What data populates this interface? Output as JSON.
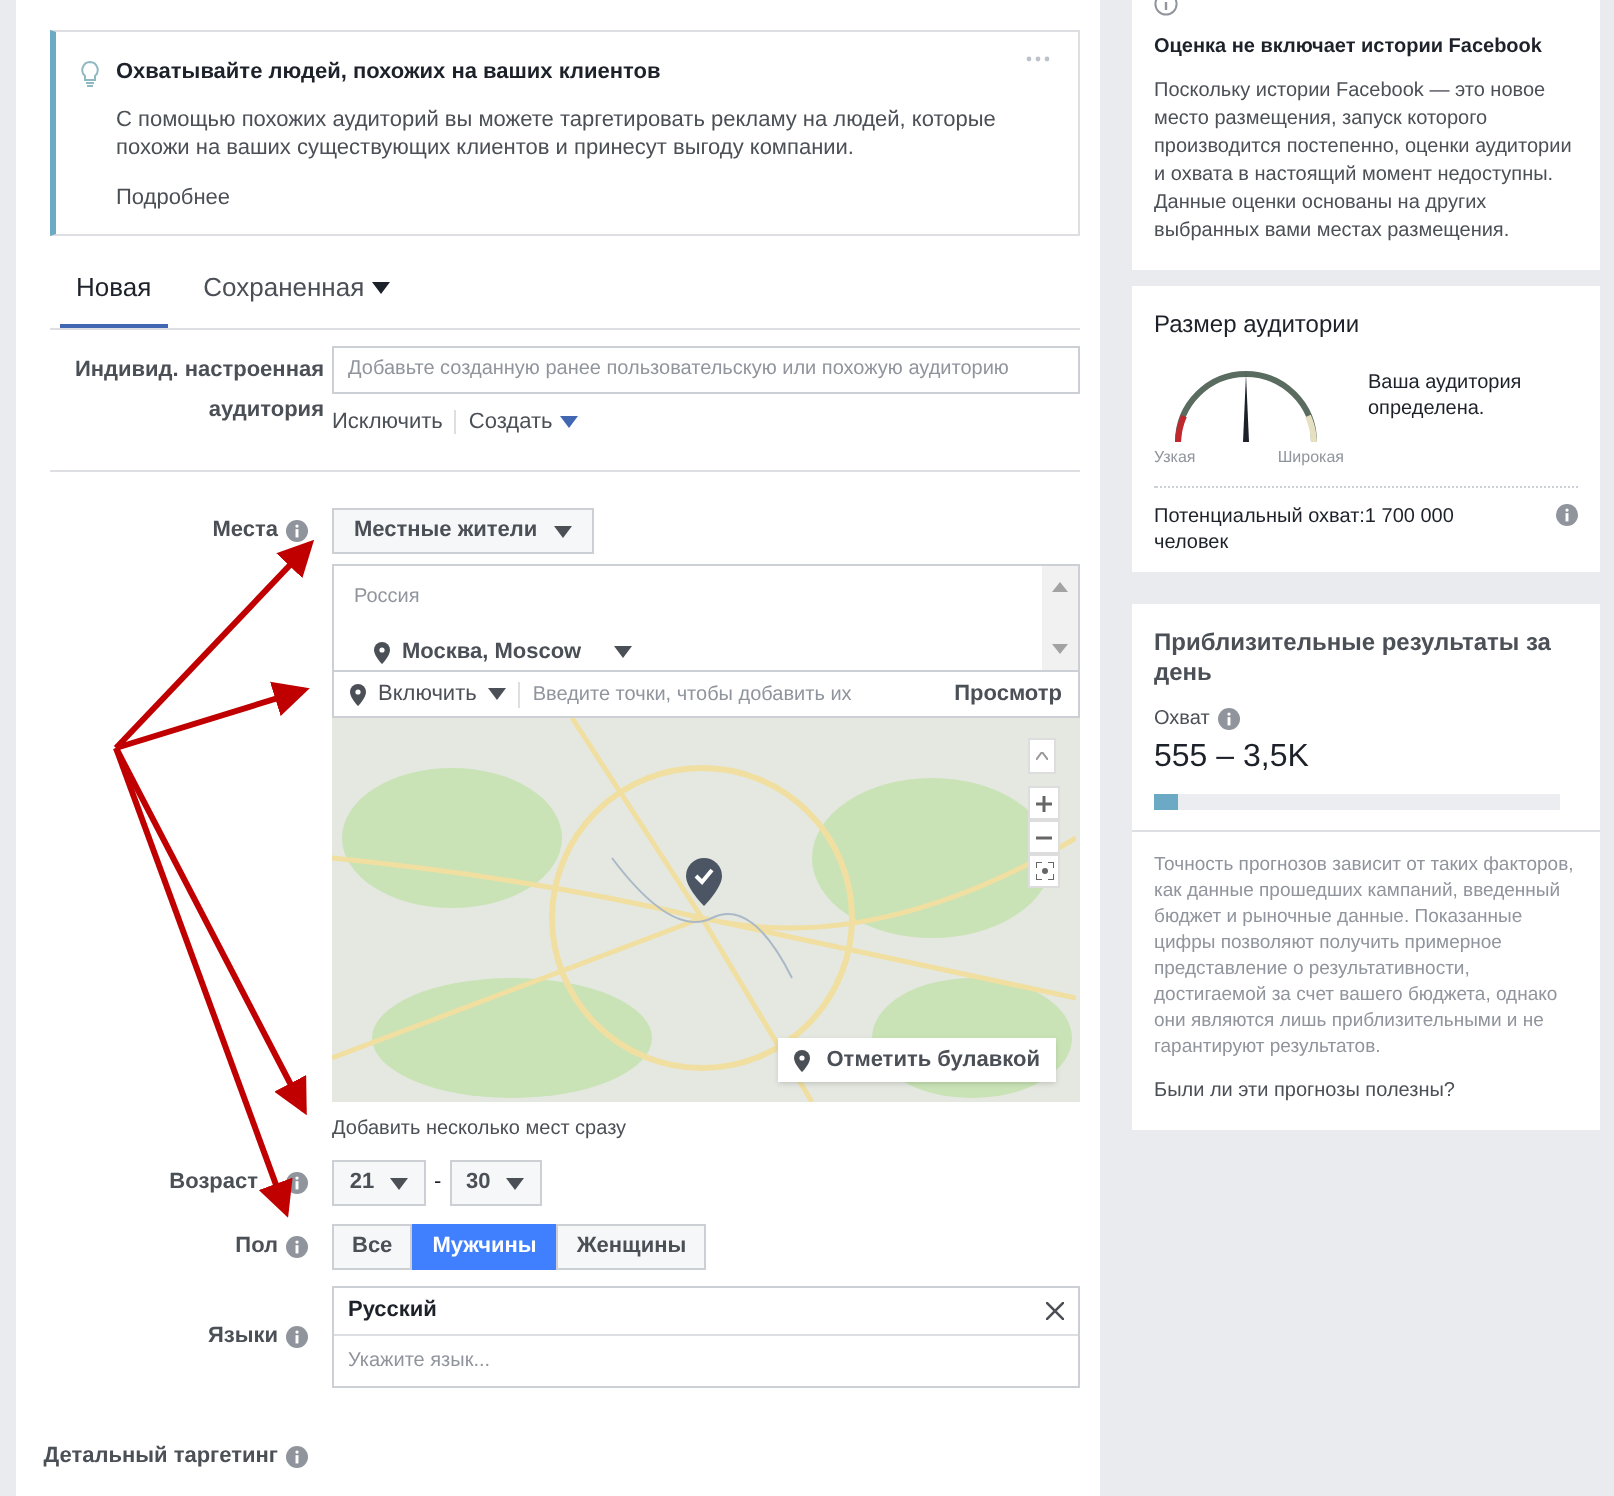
{
  "tip": {
    "title": "Охватывайте людей, похожих на ваших клиентов",
    "text": "С помощью похожих аудиторий вы можете таргетировать рекламу на людей, которые похожи на ваших существующих клиентов и принесут выгоду компании.",
    "link": "Подробнее"
  },
  "tabs": [
    {
      "label": "Новая",
      "selected": true,
      "dropdown": false
    },
    {
      "label": "Сохраненная",
      "selected": false,
      "dropdown": true
    }
  ],
  "custom_audience": {
    "label": "Индивид. настроенная аудитория",
    "placeholder": "Добавьте созданную ранее пользовательскую или похожую аудиторию",
    "exclude": "Исключить",
    "create": "Создать"
  },
  "places": {
    "label": "Места",
    "dropdown": "Местные жители",
    "country": "Россия",
    "location": "Москва, Moscow",
    "include": "Включить",
    "search_placeholder": "Введите точки, чтобы добавить их",
    "browse": "Просмотр",
    "pin_button": "Отметить булавкой",
    "bulk_link": "Добавить несколько мест сразу"
  },
  "age": {
    "label": "Возраст",
    "from": "21",
    "separator": "-",
    "to": "30"
  },
  "gender": {
    "label": "Пол",
    "options": [
      {
        "label": "Все",
        "selected": false
      },
      {
        "label": "Мужчины",
        "selected": true
      },
      {
        "label": "Женщины",
        "selected": false
      }
    ]
  },
  "languages": {
    "label": "Языки",
    "tags": [
      "Русский"
    ],
    "placeholder": "Укажите язык..."
  },
  "detailed_targeting": {
    "label": "Детальный таргетинг"
  },
  "notice": {
    "title": "Оценка не включает истории Facebook",
    "text": "Поскольку истории Facebook — это новое место размещения, запуск которого производится постепенно, оценки аудитории и охвата в настоящий момент недоступны. Данные оценки основаны на других выбранных вами местах размещения."
  },
  "audience_size": {
    "title": "Размер аудитории",
    "narrow": "Узкая",
    "wide": "Широкая",
    "status": "Ваша аудитория определена.",
    "reach": "Потенциальный охват:1 700 000 человек"
  },
  "daily_results": {
    "title": "Приблизительные результаты за день",
    "metric": "Охват",
    "value": "555 – 3,5K",
    "level": 0.06,
    "disclaimer": "Точность прогнозов зависит от таких факторов, как данные прошедших кампаний, введенный бюджет и рыночные данные. Показанные цифры позволяют получить примерное представление о результативности, достигаемой за счет вашего бюджета, однако они являются лишь приблизительными и не гарантируют результатов.",
    "feedback": "Были ли эти прогнозы полезны?"
  }
}
